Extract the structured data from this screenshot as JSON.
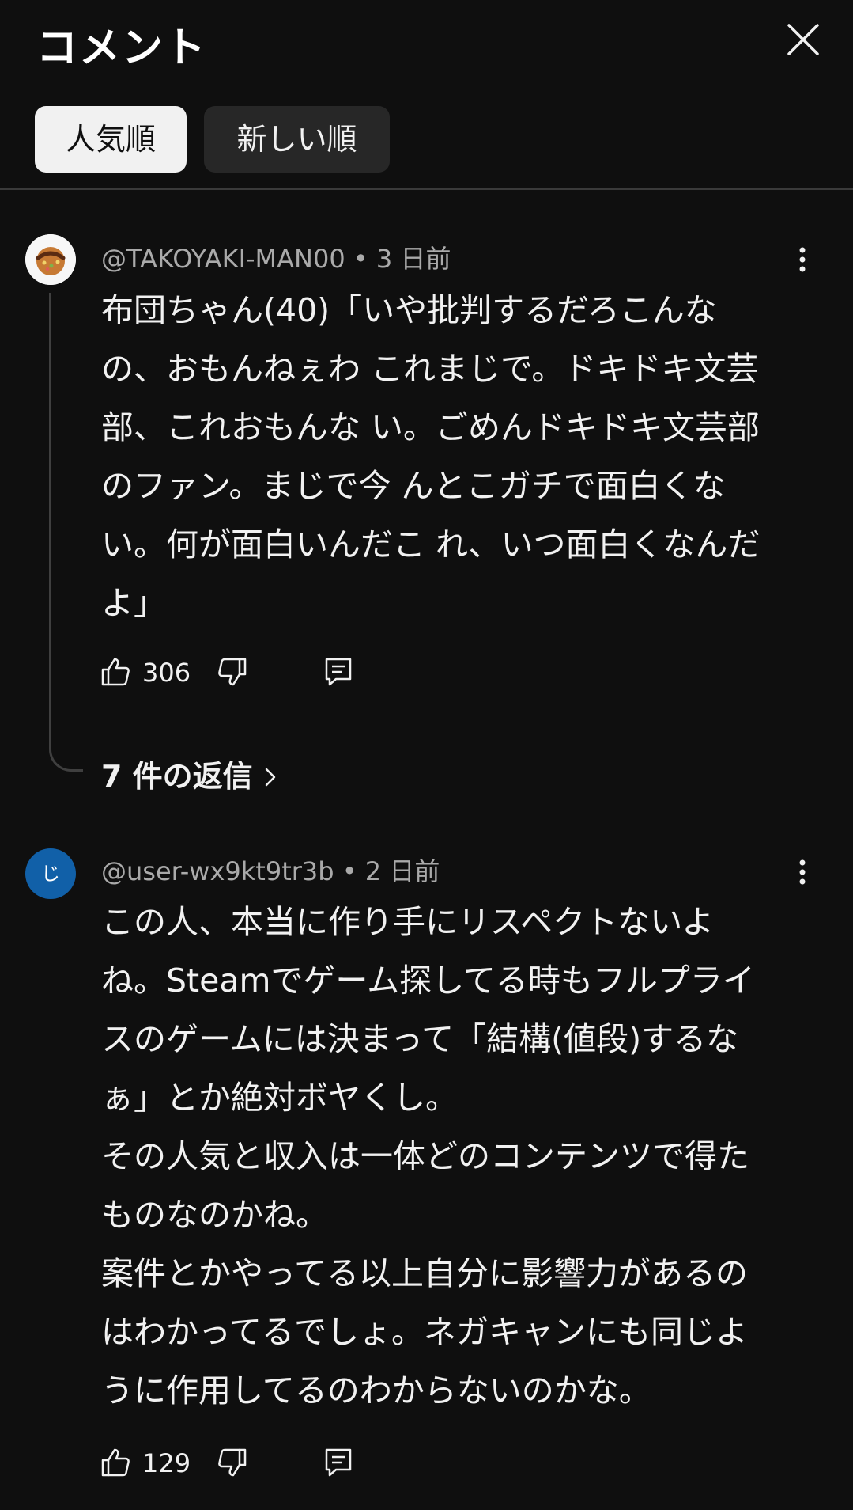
{
  "header": {
    "title": "コメント",
    "close_icon": "close-icon"
  },
  "sort_chips": {
    "popular": "人気順",
    "newest": "新しい順",
    "selected": "popular"
  },
  "comments": [
    {
      "avatar_icon": "takoyaki-avatar",
      "author": "@TAKOYAKI-MAN00",
      "separator": " • ",
      "time": "3 日前",
      "text": "布団ちゃん(40)「いや批判するだろこんな\nの、おもんねぇわ これまじで。ドキドキ文芸\n部、これおもんな い。ごめんドキドキ文芸部\nのファン。まじで今 んとこガチで面白くな\nい。何が面白いんだこ れ、いつ面白くなんだ\nよ」",
      "likes": "306",
      "replies_label": "7 件の返信"
    },
    {
      "avatar_text": "じ",
      "avatar_color": "#1160a8",
      "author": "@user-wx9kt9tr3b",
      "separator": " • ",
      "time": "2 日前",
      "text": "この人、本当に作り手にリスペクトないよ\nね。Steamでゲーム探してる時もフルプライ\nスのゲームには決まって「結構(値段)するな\nぁ」とか絶対ボヤくし。\nその人気と収入は一体どのコンテンツで得た\nものなのかね。\n案件とかやってる以上自分に影響力があるの\nはわかってるでしょ。ネガキャンにも同じよ\nうに作用してるのわからないのかな。",
      "likes": "129"
    }
  ]
}
